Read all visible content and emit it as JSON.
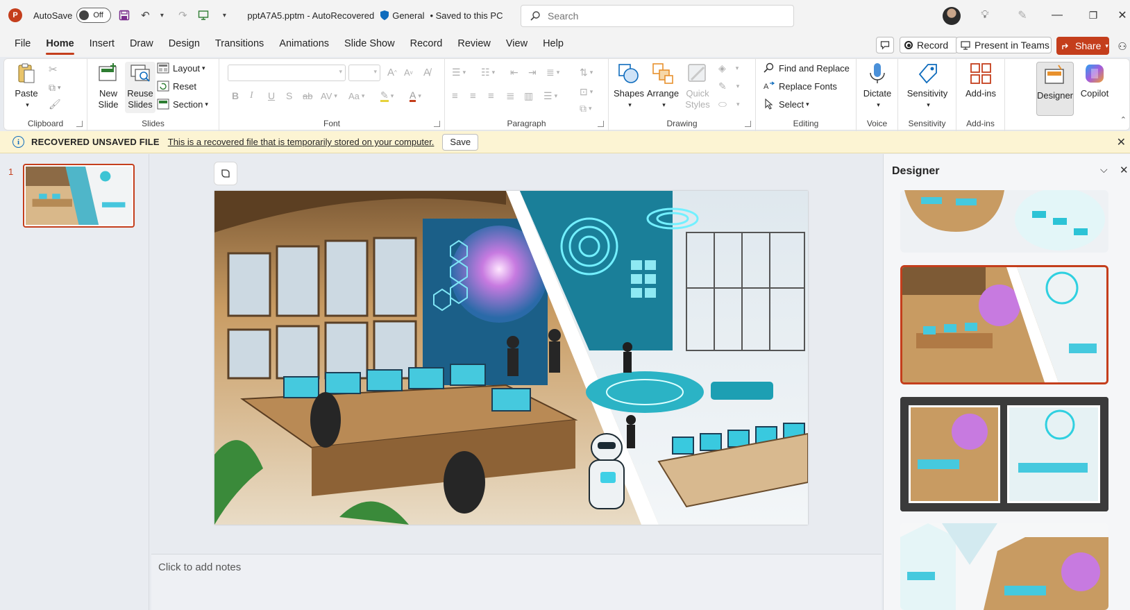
{
  "titlebar": {
    "autosave_label": "AutoSave",
    "autosave_state": "Off",
    "doc_title": "pptA7A5.pptm  -  AutoRecovered",
    "sensitivity": "General",
    "save_status": "•  Saved to this PC",
    "search_placeholder": "Search"
  },
  "menu": {
    "tabs": [
      "File",
      "Home",
      "Insert",
      "Draw",
      "Design",
      "Transitions",
      "Animations",
      "Slide Show",
      "Record",
      "Review",
      "View",
      "Help"
    ],
    "active": "Home",
    "record_label": "Record",
    "teams_label": "Present in Teams",
    "share_label": "Share"
  },
  "ribbon": {
    "clipboard": {
      "label": "Clipboard",
      "paste": "Paste"
    },
    "slides": {
      "label": "Slides",
      "new_slide_1": "New",
      "new_slide_2": "Slide",
      "reuse_1": "Reuse",
      "reuse_2": "Slides",
      "layout": "Layout",
      "reset": "Reset",
      "section": "Section"
    },
    "font": {
      "label": "Font"
    },
    "paragraph": {
      "label": "Paragraph"
    },
    "drawing": {
      "label": "Drawing",
      "shapes": "Shapes",
      "arrange": "Arrange",
      "quick_styles_1": "Quick",
      "quick_styles_2": "Styles"
    },
    "editing": {
      "label": "Editing",
      "find_replace": "Find and Replace",
      "replace_fonts": "Replace Fonts",
      "select": "Select"
    },
    "voice": {
      "label": "Voice",
      "dictate": "Dictate"
    },
    "sensitivity": {
      "label": "Sensitivity",
      "button": "Sensitivity"
    },
    "addins": {
      "label": "Add-ins",
      "button": "Add-ins"
    },
    "designer": {
      "button": "Designer"
    },
    "copilot": {
      "button": "Copilot"
    }
  },
  "infobar": {
    "title": "RECOVERED UNSAVED FILE",
    "message": "This is a recovered file that is temporarily stored on your computer.",
    "save": "Save"
  },
  "thumbnails": {
    "slide_number": "1"
  },
  "notes": {
    "placeholder": "Click to add notes"
  },
  "designer": {
    "title": "Designer"
  },
  "colors": {
    "accent": "#c43e1c",
    "infobar": "#fcf4d3"
  }
}
